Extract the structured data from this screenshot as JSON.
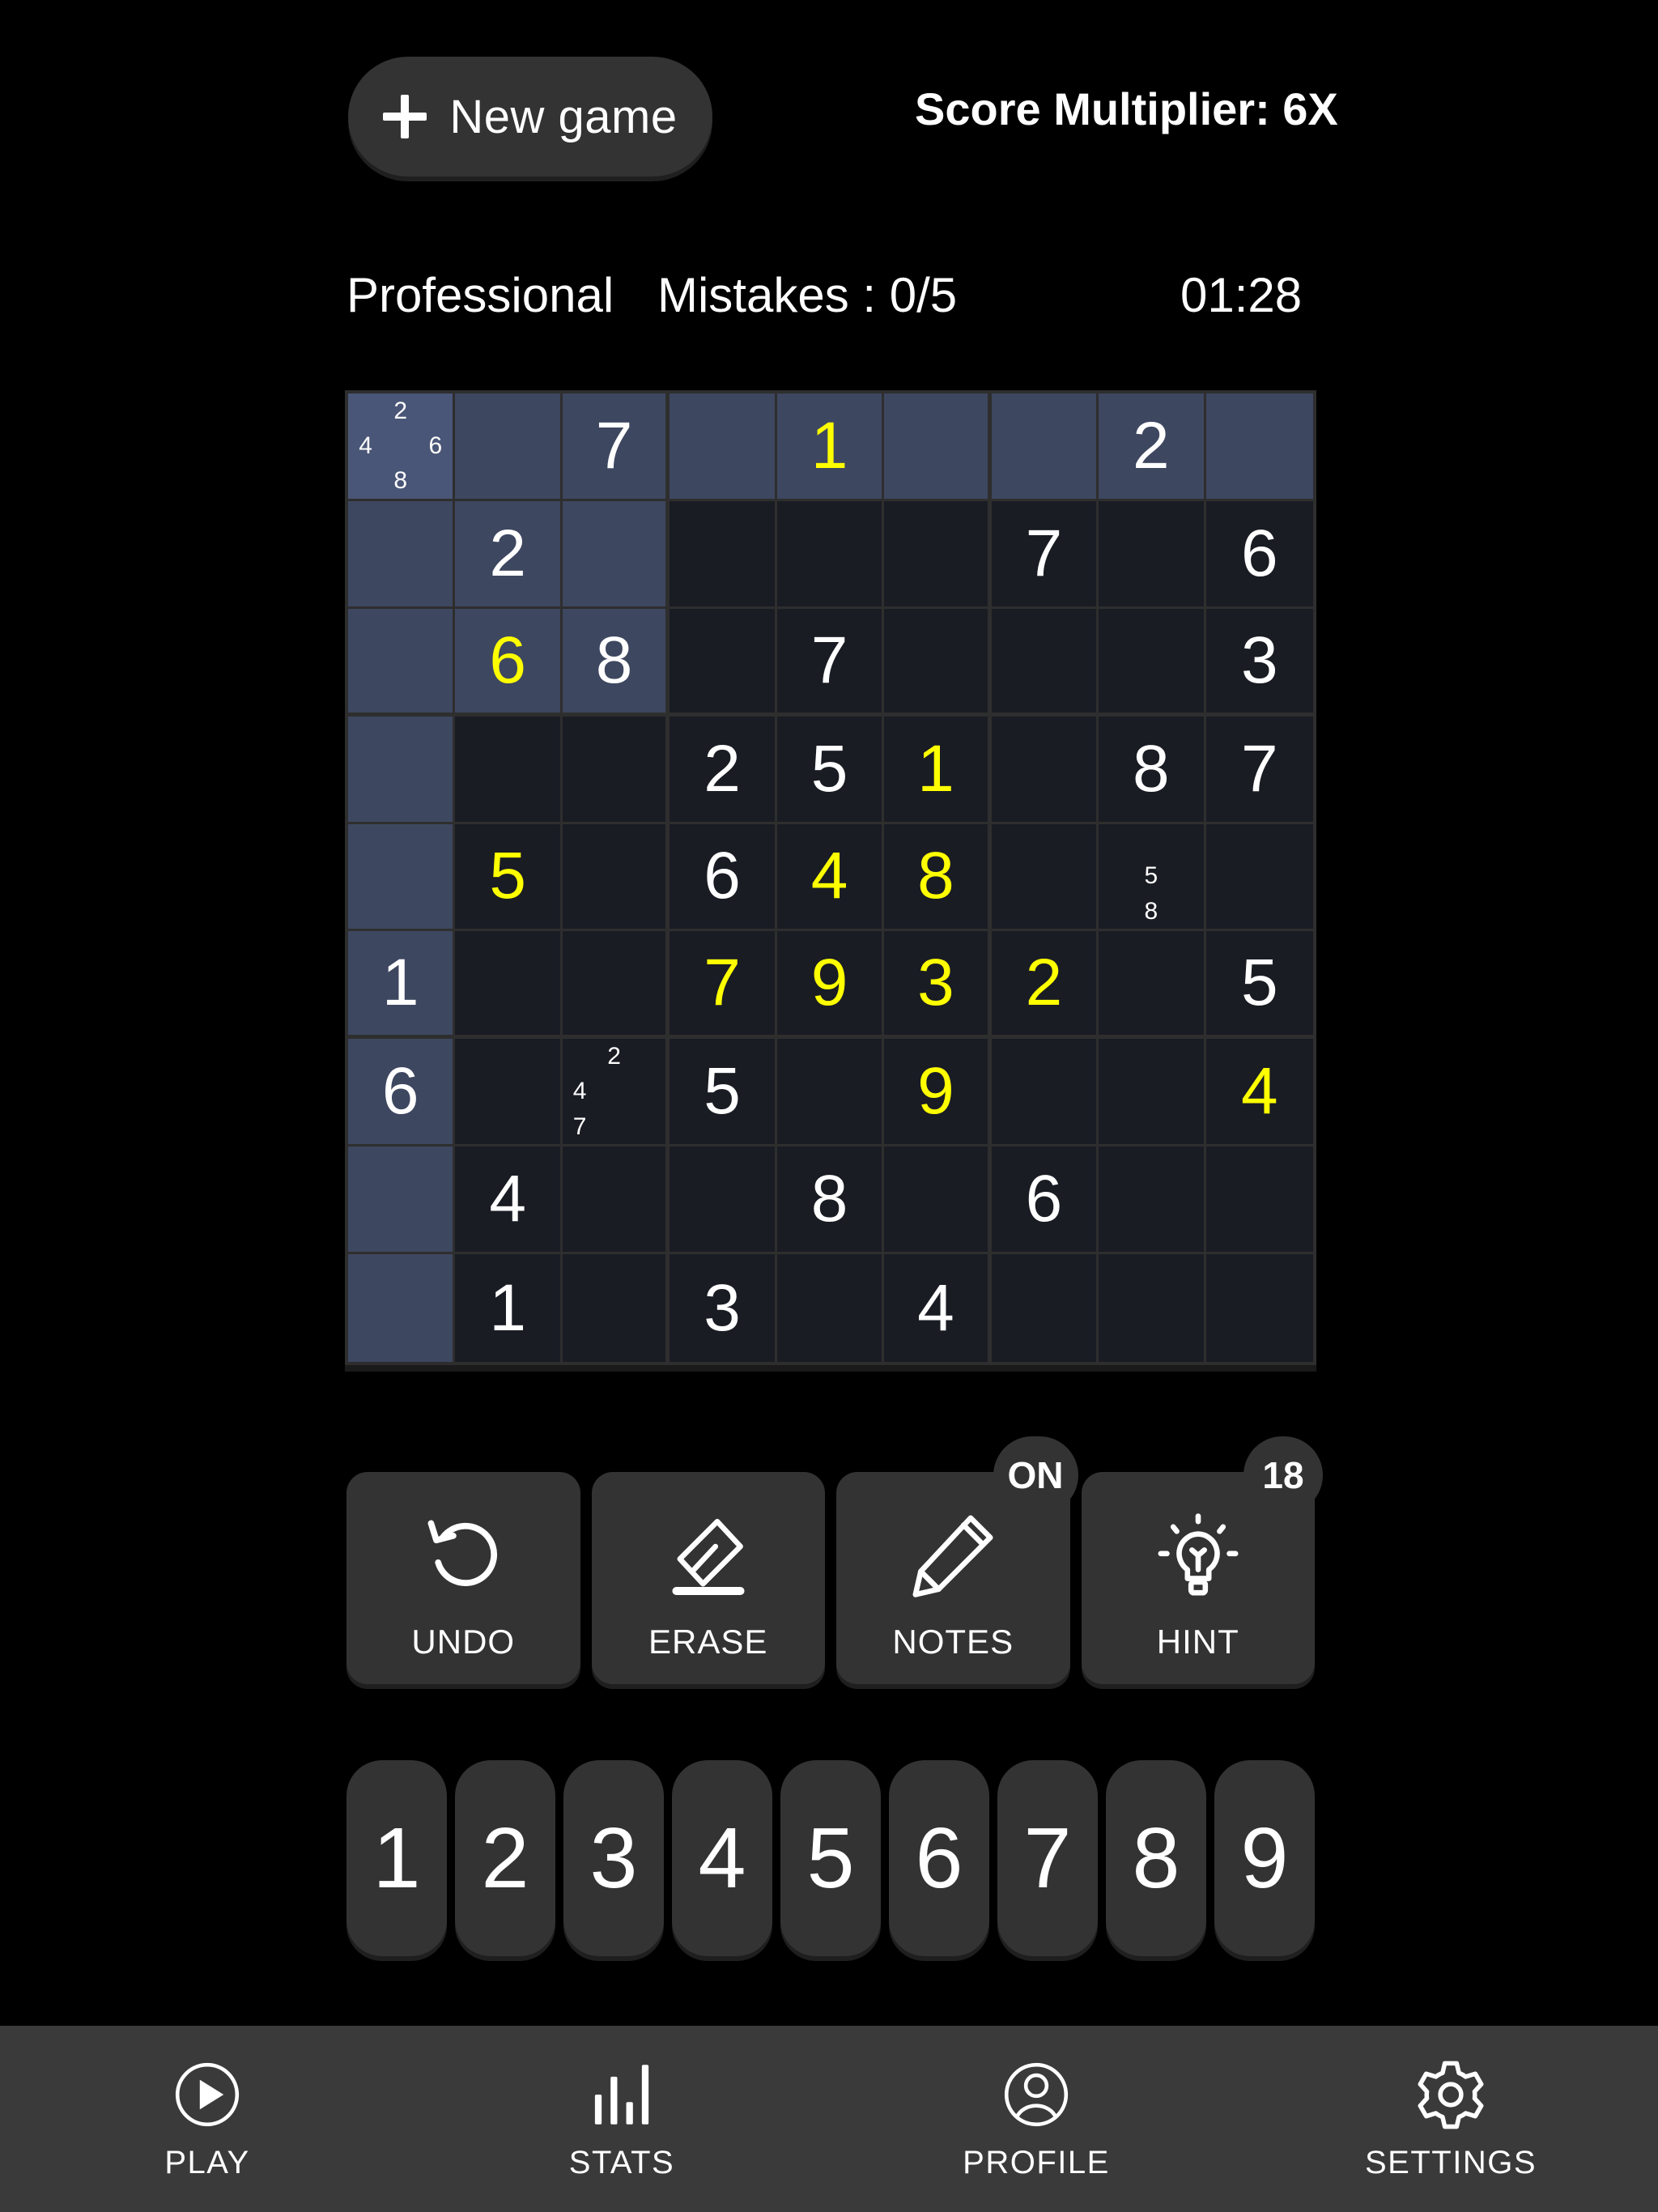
{
  "header": {
    "new_game_label": "New game",
    "new_game_icon": "plus-icon",
    "score_multiplier": "Score Multiplier: 6X"
  },
  "status": {
    "difficulty": "Professional",
    "mistakes": "Mistakes : 0/5",
    "timer": "01:28"
  },
  "board": {
    "selected_cell": {
      "row": 1,
      "col": 1
    },
    "highlight_row": 1,
    "highlight_col": 1,
    "highlight_box": {
      "row": 1,
      "col": 1
    },
    "colors": {
      "cell_bg": "#191c23",
      "cell_highlight": "#3e4760",
      "cell_selected": "#4a5677",
      "grid_line": "#2e2e2e",
      "given_value": "#ffffff",
      "user_value": "#ffff00"
    },
    "cells": [
      [
        {
          "notes": [
            2,
            4,
            6,
            8
          ]
        },
        {},
        {
          "v": 7,
          "t": "given"
        },
        {},
        {
          "v": 1,
          "t": "user"
        },
        {},
        {},
        {
          "v": 2,
          "t": "given"
        },
        {}
      ],
      [
        {},
        {
          "v": 2,
          "t": "given"
        },
        {},
        {},
        {},
        {},
        {
          "v": 7,
          "t": "given"
        },
        {},
        {
          "v": 6,
          "t": "given"
        }
      ],
      [
        {},
        {
          "v": 6,
          "t": "user"
        },
        {
          "v": 8,
          "t": "given"
        },
        {},
        {
          "v": 7,
          "t": "given"
        },
        {},
        {},
        {},
        {
          "v": 3,
          "t": "given"
        }
      ],
      [
        {},
        {},
        {},
        {
          "v": 2,
          "t": "given"
        },
        {
          "v": 5,
          "t": "given"
        },
        {
          "v": 1,
          "t": "user"
        },
        {},
        {
          "v": 8,
          "t": "given"
        },
        {
          "v": 7,
          "t": "given"
        }
      ],
      [
        {},
        {
          "v": 5,
          "t": "user"
        },
        {},
        {
          "v": 6,
          "t": "given"
        },
        {
          "v": 4,
          "t": "user"
        },
        {
          "v": 8,
          "t": "user"
        },
        {},
        {
          "notes": [
            5,
            8
          ]
        },
        {}
      ],
      [
        {
          "v": 1,
          "t": "given"
        },
        {},
        {},
        {
          "v": 7,
          "t": "user"
        },
        {
          "v": 9,
          "t": "user"
        },
        {
          "v": 3,
          "t": "user"
        },
        {
          "v": 2,
          "t": "user"
        },
        {},
        {
          "v": 5,
          "t": "given"
        }
      ],
      [
        {
          "v": 6,
          "t": "given"
        },
        {},
        {
          "notes": [
            2,
            4,
            7
          ]
        },
        {
          "v": 5,
          "t": "given"
        },
        {},
        {
          "v": 9,
          "t": "user"
        },
        {},
        {},
        {
          "v": 4,
          "t": "user"
        }
      ],
      [
        {},
        {
          "v": 4,
          "t": "given"
        },
        {},
        {},
        {
          "v": 8,
          "t": "given"
        },
        {},
        {
          "v": 6,
          "t": "given"
        },
        {},
        {}
      ],
      [
        {},
        {
          "v": 1,
          "t": "given"
        },
        {},
        {
          "v": 3,
          "t": "given"
        },
        {},
        {
          "v": 4,
          "t": "given"
        },
        {},
        {},
        {}
      ]
    ]
  },
  "actions": [
    {
      "label": "UNDO",
      "icon": "undo-arrow-icon",
      "badge": null
    },
    {
      "label": "ERASE",
      "icon": "eraser-icon",
      "badge": null
    },
    {
      "label": "NOTES",
      "icon": "pencil-icon",
      "badge": "ON"
    },
    {
      "label": "HINT",
      "icon": "lightbulb-icon",
      "badge": "18"
    }
  ],
  "numpad": [
    "1",
    "2",
    "3",
    "4",
    "5",
    "6",
    "7",
    "8",
    "9"
  ],
  "bottom_nav": [
    {
      "label": "PLAY",
      "icon": "play-circle-icon"
    },
    {
      "label": "STATS",
      "icon": "bar-chart-icon"
    },
    {
      "label": "PROFILE",
      "icon": "person-circle-icon"
    },
    {
      "label": "SETTINGS",
      "icon": "gear-icon"
    }
  ]
}
